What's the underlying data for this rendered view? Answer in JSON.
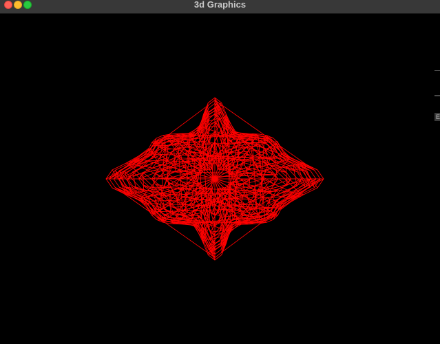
{
  "window": {
    "title": "3d Graphics",
    "controls": {
      "close": "close-button",
      "minimize": "minimize-button",
      "zoom": "zoom-button"
    }
  },
  "viewport": {
    "background": "#000000",
    "wire_color": "#ff0000",
    "shape": "superquadric-mesh-with-four-lobes"
  },
  "right_edge": {
    "marker_text": "E"
  }
}
